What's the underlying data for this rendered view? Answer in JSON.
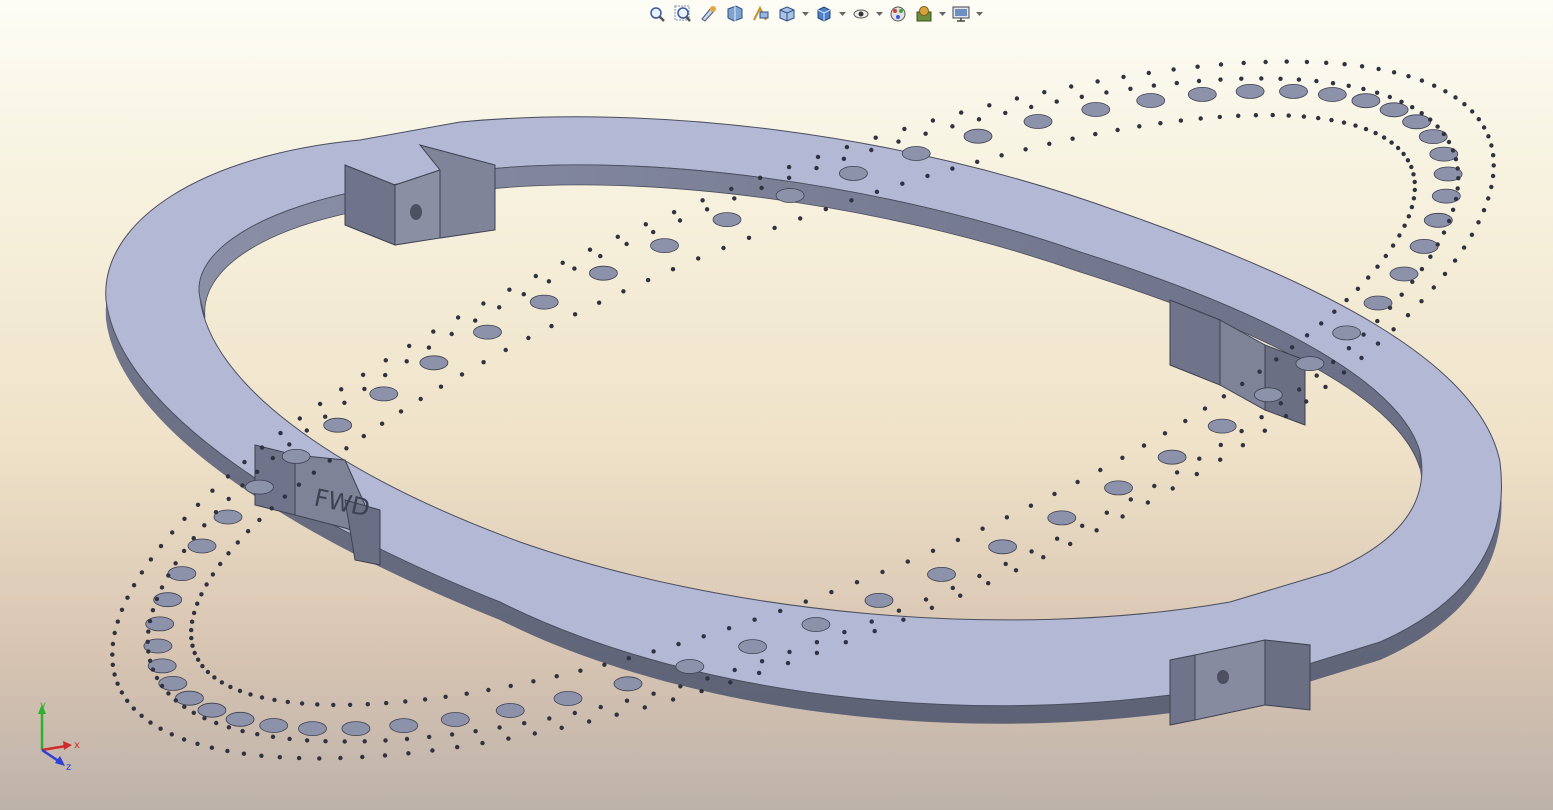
{
  "toolbar": {
    "buttons": [
      {
        "name": "zoom-to-fit-icon"
      },
      {
        "name": "zoom-to-area-icon"
      },
      {
        "name": "previous-view-icon"
      },
      {
        "name": "section-view-icon"
      },
      {
        "name": "dynamic-annotation-icon"
      },
      {
        "name": "view-orientation-icon",
        "dropdown": true
      },
      {
        "name": "display-style-icon",
        "dropdown": true
      },
      {
        "name": "hide-show-items-icon",
        "dropdown": true
      },
      {
        "name": "edit-appearance-icon"
      },
      {
        "name": "apply-scene-icon",
        "dropdown": true
      },
      {
        "name": "view-settings-icon",
        "dropdown": true
      }
    ]
  },
  "model": {
    "engraved_text": "FWD",
    "color_face": "#b3b8d4",
    "color_side": "#6c7186"
  },
  "triad": {
    "x_label": "x",
    "y_label": "y",
    "z_label": "z",
    "x_color": "#d22b2b",
    "y_color": "#2fae2f",
    "z_color": "#2c3fd6"
  }
}
